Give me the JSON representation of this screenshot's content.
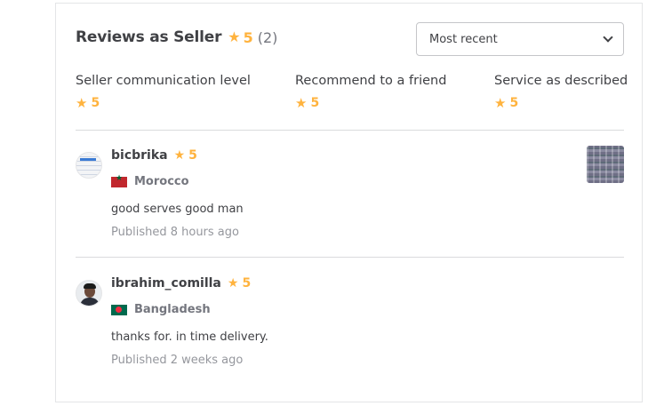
{
  "header": {
    "title": "Reviews as Seller",
    "rating": "5",
    "count": "(2)"
  },
  "sort": {
    "selected": "Most recent"
  },
  "breakdown": [
    {
      "label": "Seller communication level",
      "value": "5"
    },
    {
      "label": "Recommend to a friend",
      "value": "5"
    },
    {
      "label": "Service as described",
      "value": "5"
    }
  ],
  "reviews": [
    {
      "username": "bicbrika",
      "rating": "5",
      "country": "Morocco",
      "text": "good serves good man",
      "published": "Published 8 hours ago"
    },
    {
      "username": "ibrahim_comilla",
      "rating": "5",
      "country": "Bangladesh",
      "text": "thanks for. in time delivery.",
      "published": "Published 2 weeks ago"
    }
  ],
  "colors": {
    "star": "#ffb33e",
    "text": "#404145",
    "muted": "#74767e",
    "border": "#dadbdd"
  },
  "icons": {
    "star": "star-icon",
    "dropdown": "chevron-down-icon"
  }
}
